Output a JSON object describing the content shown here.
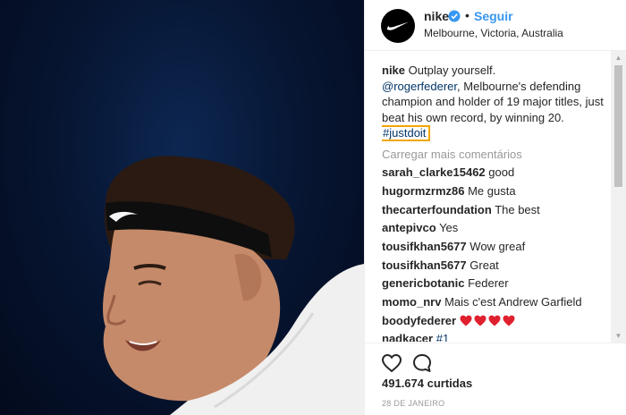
{
  "header": {
    "username": "nike",
    "separator": "•",
    "follow_label": "Seguir",
    "location": "Melbourne, Victoria, Australia"
  },
  "caption": {
    "username": "nike",
    "line1": "Outplay yourself.",
    "mention": "@rogerfederer",
    "text": ", Melbourne's defending champion and holder of 19 major titles, just beat his own record, by winning 20.",
    "hashtag": "#justdoit"
  },
  "load_more": "Carregar mais comentários",
  "comments": [
    {
      "user": "sarah_clarke15462",
      "text": "good"
    },
    {
      "user": "hugormzrmz86",
      "text": "Me gusta"
    },
    {
      "user": "thecarterfoundation",
      "text": "The best"
    },
    {
      "user": "antepivco",
      "text": "Yes"
    },
    {
      "user": "tousifkhan5677",
      "text": "Wow greaf"
    },
    {
      "user": "tousifkhan5677",
      "text": "Great"
    },
    {
      "user": "genericbotanic",
      "text": "Federer"
    },
    {
      "user": "momo_nrv",
      "text": "Mais c'est Andrew Garfield"
    },
    {
      "user": "boodyfederer",
      "text": ""
    },
    {
      "user": "nadkacer",
      "text": "#1"
    }
  ],
  "likes": "491.674 curtidas",
  "date": "28 DE JANEIRO",
  "colors": {
    "link": "#003569",
    "follow": "#3897f0",
    "highlight": "#f2a600",
    "heart": "#ed4956"
  },
  "icons": {
    "like": "heart-outline-icon",
    "comment": "speech-bubble-icon",
    "verified": "verified-badge-icon",
    "avatar": "nike-swoosh-icon"
  }
}
